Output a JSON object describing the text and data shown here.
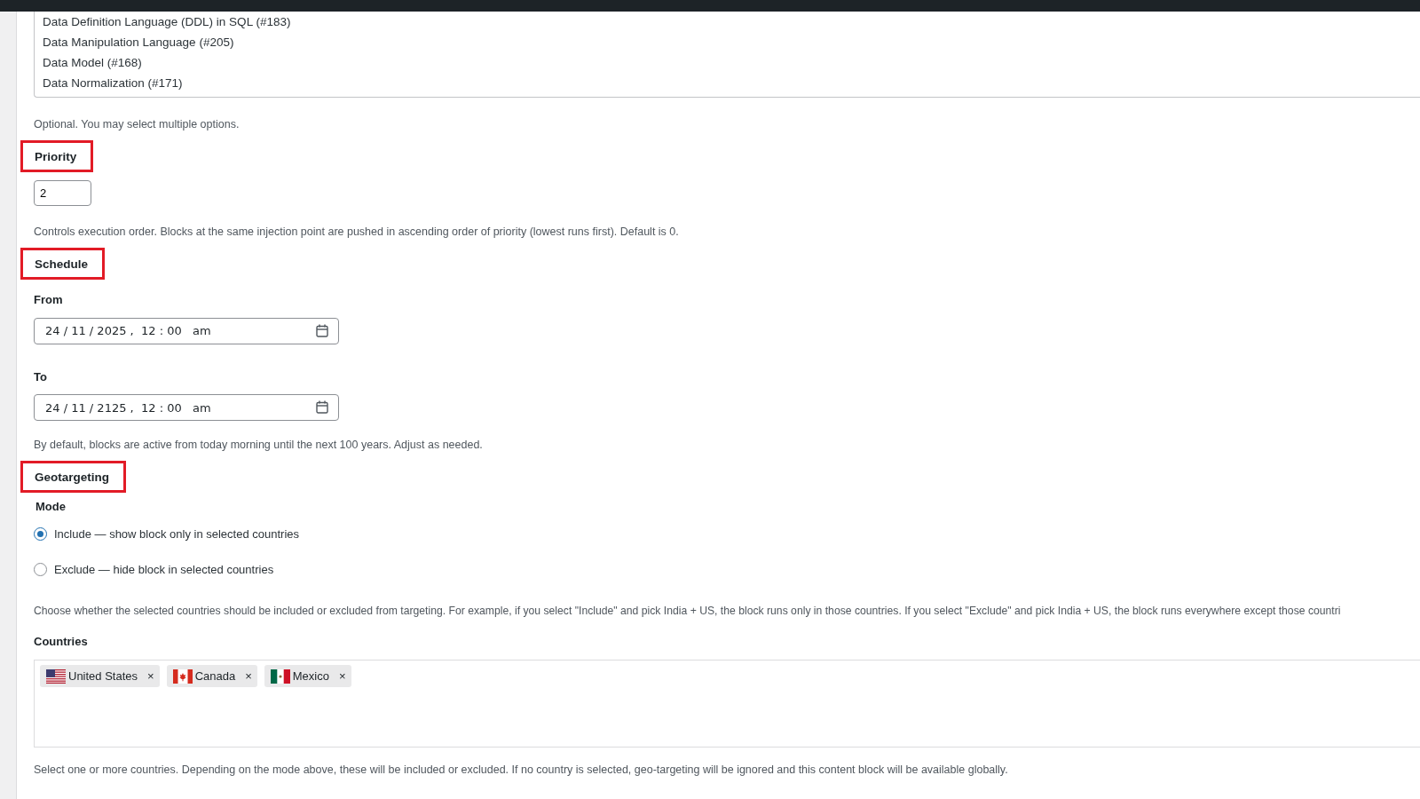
{
  "options_list": [
    {
      "label": "Data Definition Language (DDL) in SQL (#183)",
      "selected": false
    },
    {
      "label": "Data Manipulation Language (#205)",
      "selected": false
    },
    {
      "label": "Data Model (#168)",
      "selected": false
    },
    {
      "label": "Data Normalization (#171)",
      "selected": false
    }
  ],
  "options_help": "Optional. You may select multiple options.",
  "priority": {
    "heading": "Priority",
    "value": "2",
    "help": "Controls execution order. Blocks at the same injection point are pushed in ascending order of priority (lowest runs first). Default is 0."
  },
  "schedule": {
    "heading": "Schedule",
    "fields": [
      {
        "label": "From",
        "value": "24 / 11 / 2025 ,  12 : 00   am"
      },
      {
        "label": "To",
        "value": "24 / 11 / 2125 ,  12 : 00   am"
      }
    ],
    "help": "By default, blocks are active from today morning until the next 100 years. Adjust as needed."
  },
  "geotargeting": {
    "heading": "Geotargeting",
    "mode_label": "Mode",
    "modes": [
      {
        "label": "Include — show block only in selected countries",
        "selected": true
      },
      {
        "label": "Exclude — hide block in selected countries",
        "selected": false
      }
    ],
    "mode_help": "Choose whether the selected countries should be included or excluded from targeting. For example, if you select \"Include\" and pick India + US, the block runs only in those countries. If you select \"Exclude\" and pick India + US, the block runs everywhere except those countri",
    "countries_label": "Countries",
    "countries": [
      {
        "name": "United States",
        "remove": "×",
        "kind": "us"
      },
      {
        "name": "Canada",
        "remove": "×",
        "kind": "ca"
      },
      {
        "name": "Mexico",
        "remove": "×",
        "kind": "mx"
      }
    ],
    "countries_help": "Select one or more countries. Depending on the mode above, these will be included or excluded. If no country is selected, geo-targeting will be ignored and this content block will be available globally."
  }
}
